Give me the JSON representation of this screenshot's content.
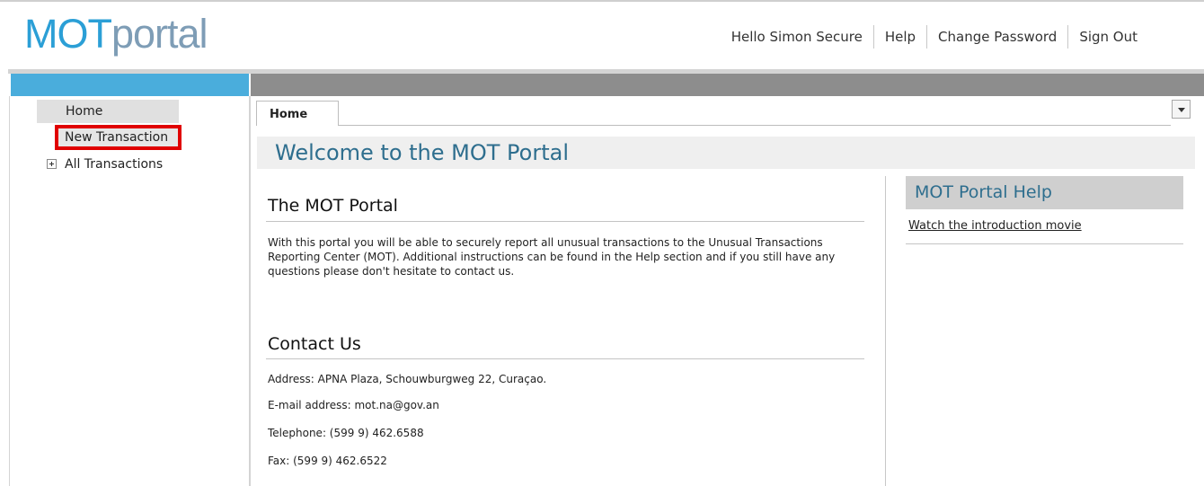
{
  "header": {
    "logo_part1": "MOT",
    "logo_part2": "portal",
    "greeting": "Hello Simon Secure",
    "help_label": "Help",
    "change_password_label": "Change Password",
    "sign_out_label": "Sign Out"
  },
  "sidebar": {
    "home_label": "Home",
    "new_transaction_label": "New Transaction",
    "all_transactions_label": "All Transactions"
  },
  "tabs": {
    "active_label": "Home"
  },
  "main": {
    "welcome_title": "Welcome to the MOT Portal",
    "portal_heading": "The MOT Portal",
    "portal_text": "With this portal you will be able to securely report all unusual transactions to the Unusual Transactions Reporting Center (MOT). Additional instructions can be found in the Help section and if you still have any questions  please don't hesitate to contact us.",
    "contact_heading": "Contact Us",
    "address": "Address: APNA Plaza, Schouwburgweg 22, Curaçao.",
    "email": "E-mail address: mot.na@gov.an",
    "telephone": "Telephone: (599 9) 462.6588",
    "fax": "Fax: (599 9) 462.6522"
  },
  "help": {
    "title": "MOT Portal Help",
    "link_label": "Watch the introduction movie"
  },
  "colors": {
    "logo_blue": "#2b9fd6",
    "logo_grey_blue": "#7e9db6",
    "sidebar_bar_blue": "#4aaddc",
    "highlight_red": "#e00000",
    "title_blue": "#2e6e8e"
  }
}
